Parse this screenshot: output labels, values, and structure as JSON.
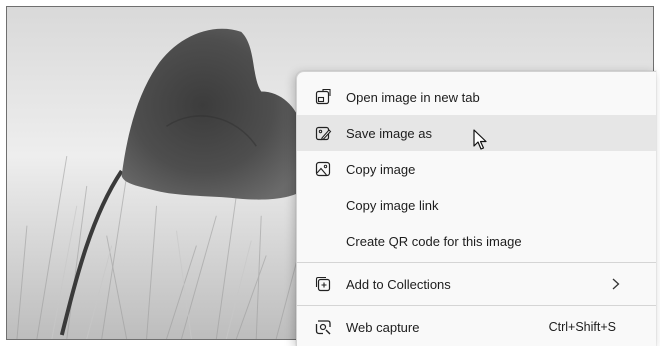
{
  "context_menu": {
    "items": [
      {
        "label": "Open image in new tab",
        "icon": "open-new-tab-icon"
      },
      {
        "label": "Save image as",
        "icon": "save-image-icon",
        "highlighted": true
      },
      {
        "label": "Copy image",
        "icon": "copy-image-icon"
      },
      {
        "label": "Copy image link",
        "icon": ""
      },
      {
        "label": "Create QR code for this image",
        "icon": ""
      },
      {
        "label": "Add to Collections",
        "icon": "add-collection-icon",
        "submenu": true
      },
      {
        "label": "Web capture",
        "icon": "web-capture-icon",
        "shortcut": "Ctrl+Shift+S"
      }
    ]
  },
  "background_image": {
    "subject": "poppy-flower-photo",
    "style": "grayscale"
  },
  "cursor": {
    "icon": "mouse-pointer-icon"
  },
  "colors": {
    "menu_bg": "#f9f9f9",
    "highlight_bg": "#e6e6e6",
    "text": "#1d1d1d",
    "divider": "#d5d5d5"
  }
}
